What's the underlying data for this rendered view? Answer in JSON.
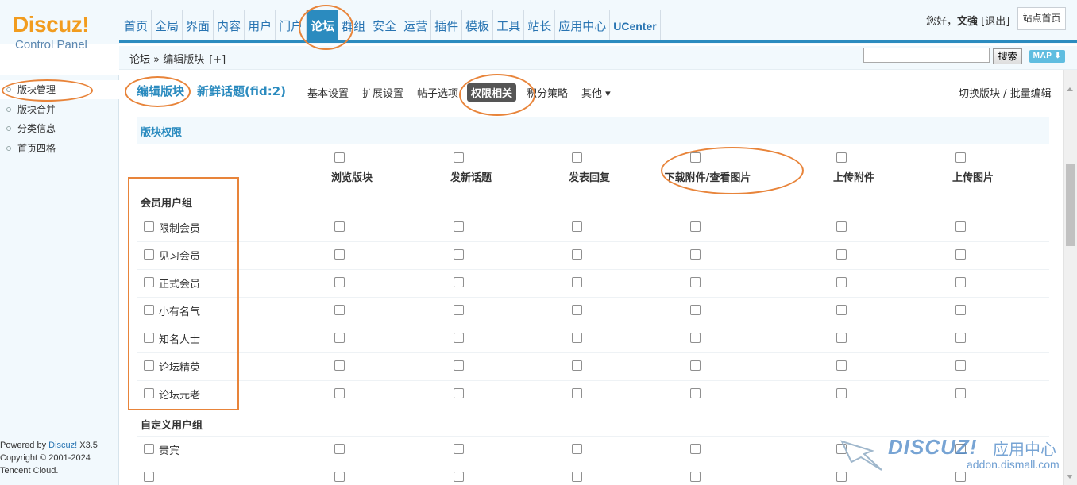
{
  "header": {
    "logo": "Discuz!",
    "logo_sub": "Control Panel",
    "nav": [
      {
        "label": "首页"
      },
      {
        "label": "全局"
      },
      {
        "label": "界面"
      },
      {
        "label": "内容"
      },
      {
        "label": "用户"
      },
      {
        "label": "门户"
      },
      {
        "label": "论坛",
        "active": true
      },
      {
        "label": "群组"
      },
      {
        "label": "安全"
      },
      {
        "label": "运营"
      },
      {
        "label": "插件"
      },
      {
        "label": "模板"
      },
      {
        "label": "工具"
      },
      {
        "label": "站长"
      },
      {
        "label": "应用中心"
      },
      {
        "label": "UCenter"
      }
    ],
    "greeting": "您好，",
    "username": "文強",
    "logout": "[退出]",
    "site_home": "站点首页"
  },
  "subheader": {
    "breadcrumb": "论坛 » 编辑版块",
    "breadcrumb_add": "[+]",
    "search_value": "",
    "search_button": "搜索",
    "map_button": "MAP ⬇"
  },
  "sidebar": {
    "items": [
      {
        "label": "版块管理",
        "active": true
      },
      {
        "label": "版块合并"
      },
      {
        "label": "分类信息"
      },
      {
        "label": "首页四格"
      }
    ],
    "footer": {
      "line1_prefix": "Powered by ",
      "line1_brand": "Discuz!",
      "line1_version": " X3.5",
      "line2": "Copyright © 2001-2024",
      "line3": "Tencent Cloud."
    }
  },
  "main": {
    "title": "编辑版块",
    "forum": "新鲜话题(fid:2)",
    "tabs": [
      {
        "label": "基本设置"
      },
      {
        "label": "扩展设置"
      },
      {
        "label": "帖子选项"
      },
      {
        "label": "权限相关",
        "active": true
      },
      {
        "label": "积分策略"
      },
      {
        "label": "其他 ▾"
      }
    ],
    "switch_link": "切换版块 / 批量编辑",
    "section_title": "版块权限",
    "columns": [
      "浏览版块",
      "发新话题",
      "发表回复",
      "下载附件/查看图片",
      "上传附件",
      "上传图片"
    ],
    "groups": [
      {
        "title": "会员用户组",
        "rows": [
          "限制会员",
          "见习会员",
          "正式会员",
          "小有名气",
          "知名人士",
          "论坛精英",
          "论坛元老"
        ]
      },
      {
        "title": "自定义用户组",
        "rows": [
          "贵宾",
          ""
        ]
      }
    ]
  },
  "watermark": {
    "brand": "DISCUZ!",
    "cn": "应用中心",
    "url": "addon.dismall.com"
  },
  "colors": {
    "accent": "#2b8bbf",
    "nav_text": "#2874b2",
    "logo": "#f29c1e",
    "panel_bg": "#f2f9fd",
    "annotation": "#e8843a"
  }
}
